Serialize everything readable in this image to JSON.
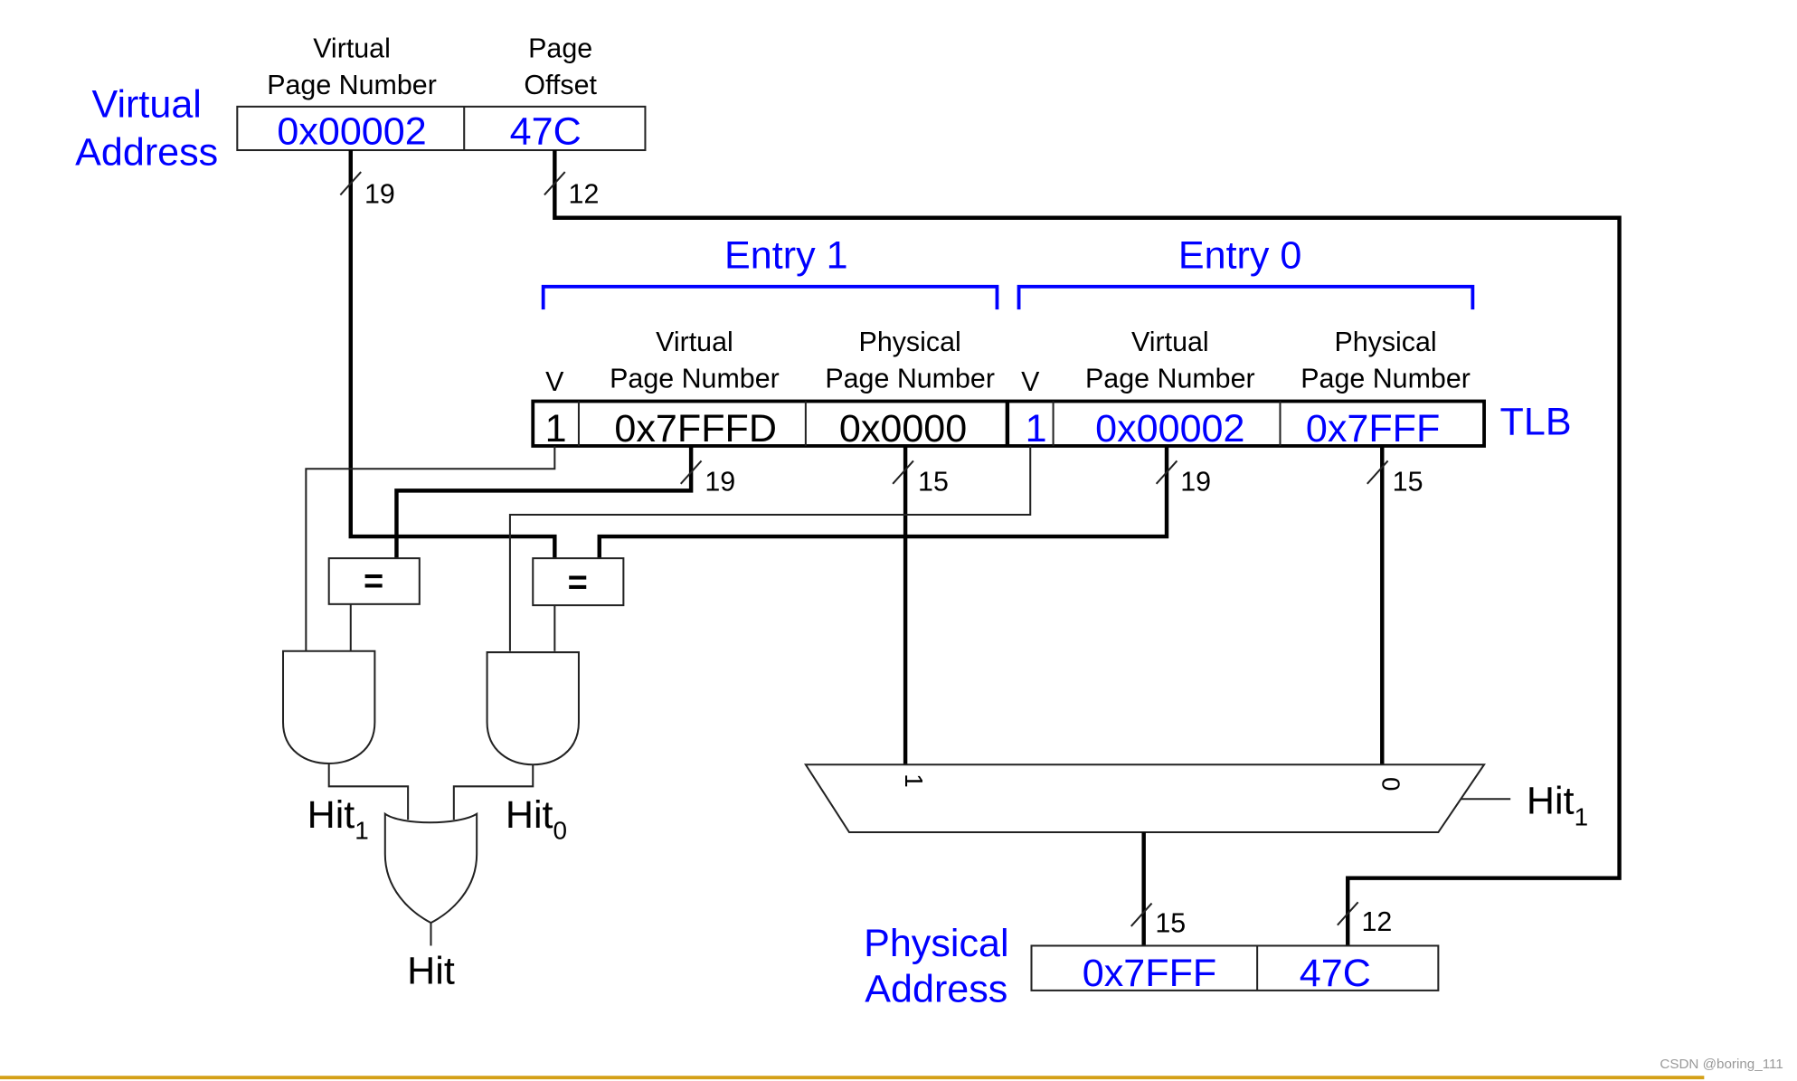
{
  "virtual_address": {
    "title_line1": "Virtual",
    "title_line2": "Address",
    "vpn_header_line1": "Virtual",
    "vpn_header_line2": "Page Number",
    "offset_header_line1": "Page",
    "offset_header_line2": "Offset",
    "vpn_value": "0x00002",
    "offset_value": "47C",
    "vpn_width": "19",
    "offset_width": "12"
  },
  "tlb": {
    "label": "TLB",
    "entry1": {
      "title": "Entry 1",
      "v_header": "V",
      "vpn_header_line1": "Virtual",
      "vpn_header_line2": "Page Number",
      "ppn_header_line1": "Physical",
      "ppn_header_line2": "Page Number",
      "v": "1",
      "vpn": "0x7FFFD",
      "ppn": "0x0000",
      "vpn_width": "19",
      "ppn_width": "15"
    },
    "entry0": {
      "title": "Entry 0",
      "v_header": "V",
      "vpn_header_line1": "Virtual",
      "vpn_header_line2": "Page Number",
      "ppn_header_line1": "Physical",
      "ppn_header_line2": "Page Number",
      "v": "1",
      "vpn": "0x00002",
      "ppn": "0x7FFF",
      "vpn_width": "19",
      "ppn_width": "15"
    }
  },
  "logic": {
    "comparator_symbol": "=",
    "hit1_label": "Hit",
    "hit1_sub": "1",
    "hit0_label": "Hit",
    "hit0_sub": "0",
    "hit_label": "Hit",
    "mux_input1": "1",
    "mux_input0": "0",
    "mux_select_label": "Hit",
    "mux_select_sub": "1",
    "mux_out_width": "15",
    "offset_width": "12"
  },
  "physical_address": {
    "title_line1": "Physical",
    "title_line2": "Address",
    "ppn_value": "0x7FFF",
    "offset_value": "47C"
  },
  "watermark": "CSDN @boring_111",
  "colors": {
    "highlight": "#0000ff",
    "footer_rule": "#d4a017"
  }
}
